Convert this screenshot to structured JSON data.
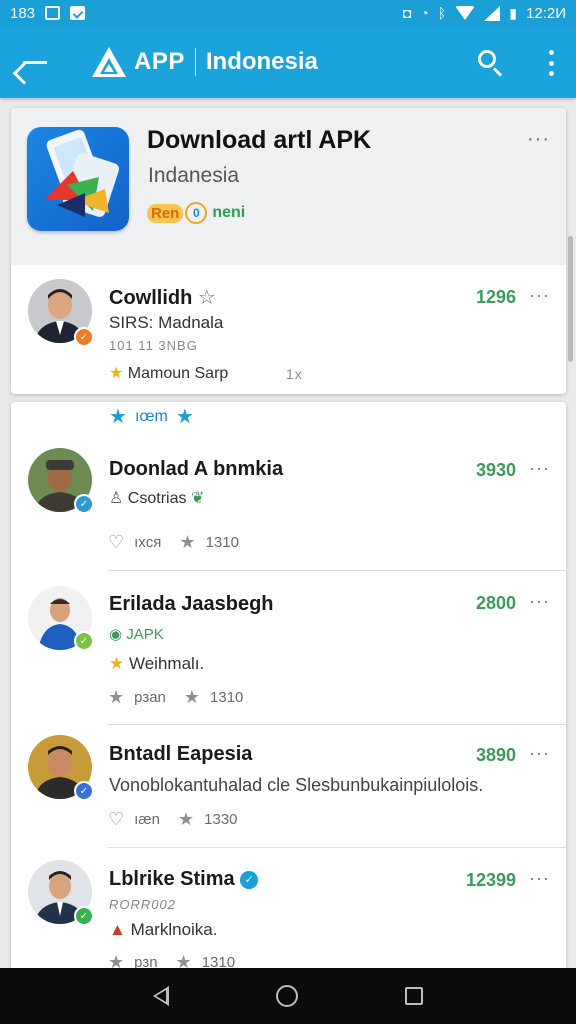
{
  "status_bar": {
    "left_text": "183",
    "time": "12:2И"
  },
  "app_bar": {
    "app_name": "APP",
    "region": "Indonesia",
    "back_icon": "back-arrow-icon",
    "search_icon": "search-icon",
    "menu_icon": "overflow-menu-icon",
    "colors": {
      "bar": "#1ba3dc",
      "status": "#1a9fd6"
    }
  },
  "featured": {
    "title": "Download artl APK",
    "subtitle": "Indanesia",
    "badge_pill": "Ren",
    "badge_ring": "0",
    "badge_text": "neni",
    "more": "···"
  },
  "items": [
    {
      "title": "Cowllidh",
      "line1": "SIRS: Madnala",
      "line2": "101 11 3NBG",
      "rating_label": "Mamoun Sarp",
      "extra": "1x",
      "count": "1296",
      "more": "···"
    },
    {
      "promo": "ıœm",
      "title": "Doonlad A bnmkia",
      "line1": "Csotrias",
      "stat1": "ıxcя",
      "stat2": "1310",
      "count": "3930",
      "more": "···"
    },
    {
      "title": "Erilada Jaasbegh",
      "line1": "JAPK",
      "rating_label": "Weihmalı.",
      "stat1": "рзan",
      "stat2": "1310",
      "count": "2800",
      "more": "···"
    },
    {
      "title": "Bntadl Eapesia",
      "line1": "Vonoblokantuhalad cle Slesbunbukainpiulolois.",
      "stat1": "ıæn",
      "stat2": "1330",
      "count": "3890",
      "more": "···"
    },
    {
      "title": "Lblrike Stima",
      "line1": "RORR002",
      "line2": "Marklnoika.",
      "stat1": "рзn",
      "stat2": "1310",
      "count": "12399",
      "more": "···"
    }
  ],
  "nav": {
    "back": "nav-back-icon",
    "home": "nav-home-icon",
    "recents": "nav-recents-icon"
  }
}
